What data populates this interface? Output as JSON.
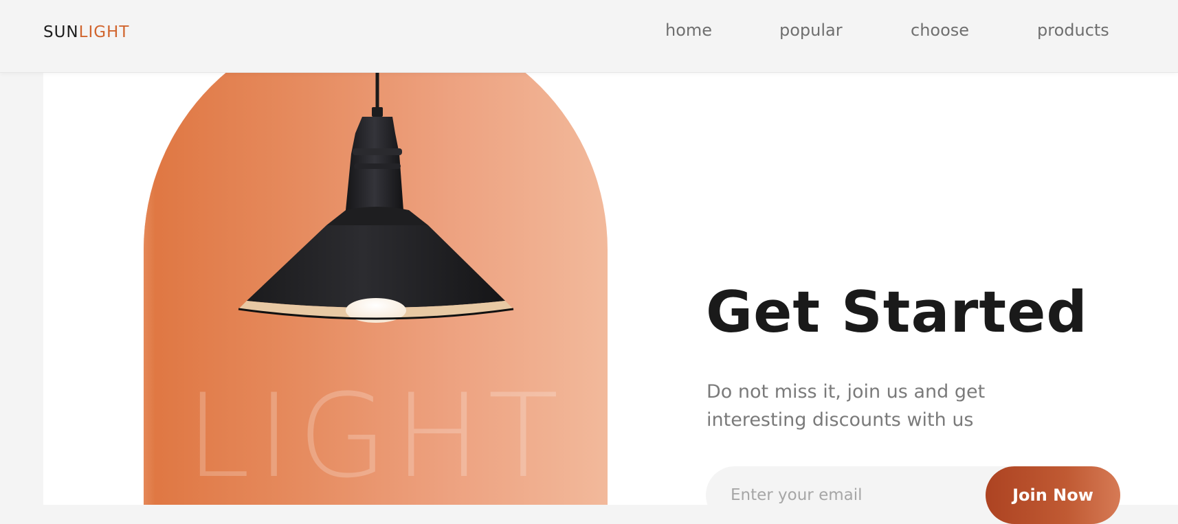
{
  "header": {
    "logo": {
      "part1": "SUN",
      "part2": "LIGHT"
    },
    "nav": [
      {
        "label": "home"
      },
      {
        "label": "popular"
      },
      {
        "label": "choose"
      },
      {
        "label": "products"
      }
    ]
  },
  "hero": {
    "background_word": "LIGHT",
    "title": "Get Started",
    "subtitle": "Do not miss it, join us and get interesting discounts with us",
    "email_placeholder": "Enter your email",
    "button_label": "Join Now"
  },
  "colors": {
    "accent": "#d1652e",
    "button": "#b54a27",
    "card_start": "#df7641",
    "card_end": "#f2b99b"
  }
}
